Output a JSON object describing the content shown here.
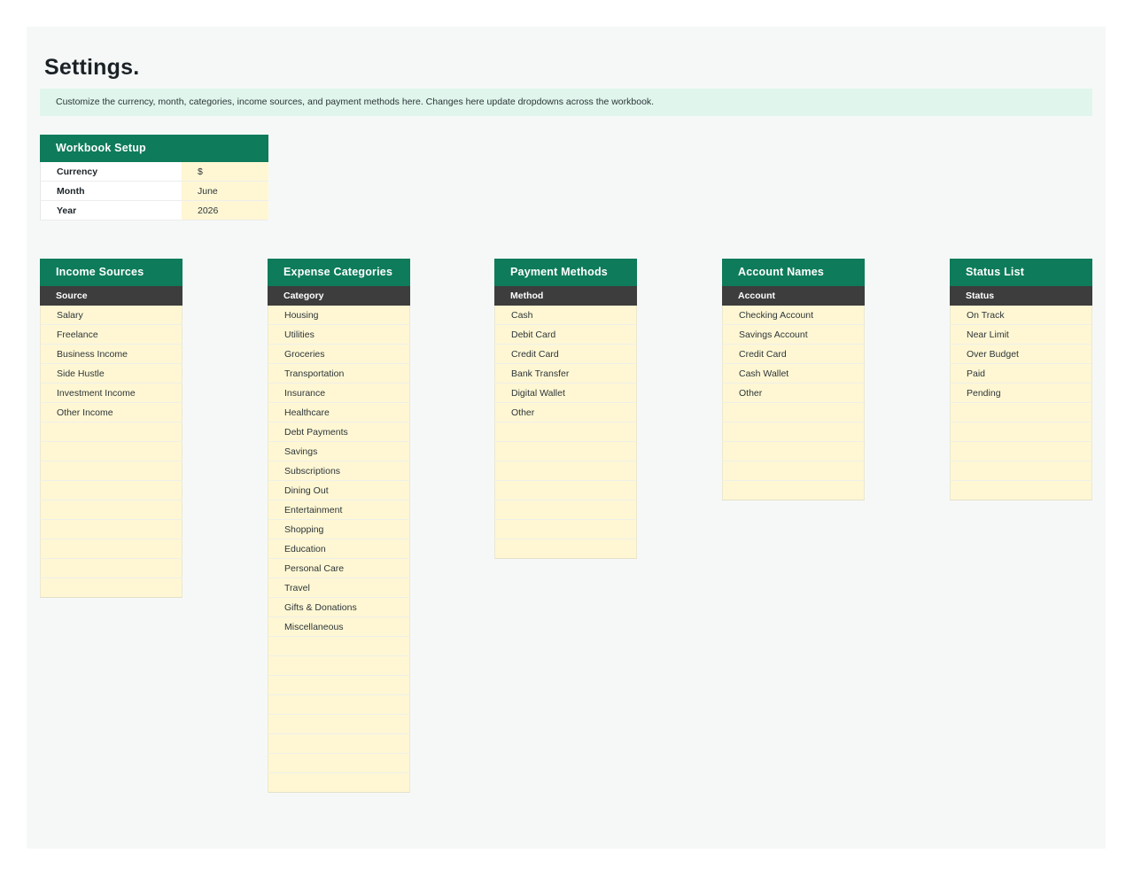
{
  "page_title": "Settings.",
  "note": "Customize the currency, month, categories, income sources, and payment methods here. Changes here update dropdowns across the workbook.",
  "workbook_setup": {
    "title": "Workbook Setup",
    "rows": [
      {
        "label": "Currency",
        "value": "$"
      },
      {
        "label": "Month",
        "value": "June"
      },
      {
        "label": "Year",
        "value": "2026"
      }
    ]
  },
  "lists": [
    {
      "title": "Income Sources",
      "subheader": "Source",
      "items": [
        "Salary",
        "Freelance",
        "Business Income",
        "Side Hustle",
        "Investment Income",
        "Other Income"
      ],
      "total_rows": 15
    },
    {
      "title": "Expense Categories",
      "subheader": "Category",
      "items": [
        "Housing",
        "Utilities",
        "Groceries",
        "Transportation",
        "Insurance",
        "Healthcare",
        "Debt Payments",
        "Savings",
        "Subscriptions",
        "Dining Out",
        "Entertainment",
        "Shopping",
        "Education",
        "Personal Care",
        "Travel",
        "Gifts & Donations",
        "Miscellaneous"
      ],
      "total_rows": 25
    },
    {
      "title": "Payment Methods",
      "subheader": "Method",
      "items": [
        "Cash",
        "Debit Card",
        "Credit Card",
        "Bank Transfer",
        "Digital Wallet",
        "Other"
      ],
      "total_rows": 13
    },
    {
      "title": "Account Names",
      "subheader": "Account",
      "items": [
        "Checking Account",
        "Savings Account",
        "Credit Card",
        "Cash Wallet",
        "Other"
      ],
      "total_rows": 10
    },
    {
      "title": "Status List",
      "subheader": "Status",
      "items": [
        "On Track",
        "Near Limit",
        "Over Budget",
        "Paid",
        "Pending"
      ],
      "total_rows": 10
    }
  ]
}
